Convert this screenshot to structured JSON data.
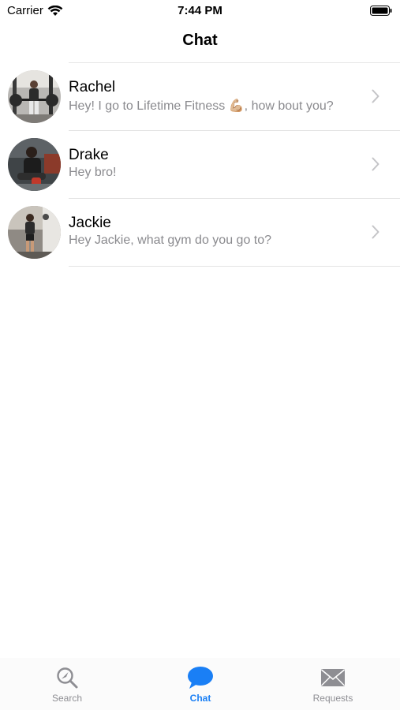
{
  "status_bar": {
    "carrier": "Carrier",
    "time": "7:44 PM"
  },
  "nav": {
    "title": "Chat"
  },
  "chats": [
    {
      "name": "Rachel",
      "preview": "Hey! I go to Lifetime Fitness 💪🏼, how bout you?"
    },
    {
      "name": "Drake",
      "preview": "Hey bro!"
    },
    {
      "name": "Jackie",
      "preview": "Hey Jackie, what gym do you go to?"
    }
  ],
  "tab_bar": {
    "tabs": [
      {
        "label": "Search",
        "icon": "search-icon"
      },
      {
        "label": "Chat",
        "icon": "chat-bubble-icon"
      },
      {
        "label": "Requests",
        "icon": "envelope-icon"
      }
    ],
    "active": "Chat",
    "active_color": "#1a7ff5",
    "inactive_color": "#8e8e93"
  }
}
